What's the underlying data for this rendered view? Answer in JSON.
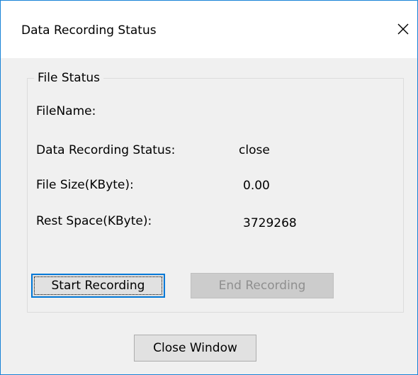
{
  "window": {
    "title": "Data Recording Status",
    "close_icon": "close-icon"
  },
  "file_status": {
    "group_title": "File Status",
    "filename_label": "FileName:",
    "filename_value": "",
    "recording_status_label": "Data Recording Status:",
    "recording_status_value": "close",
    "file_size_label": "File Size(KByte):",
    "file_size_value": "0.00",
    "rest_space_label": "Rest Space(KByte):",
    "rest_space_value": "3729268"
  },
  "buttons": {
    "start_recording": "Start Recording",
    "end_recording": "End Recording",
    "close_window": "Close Window"
  },
  "colors": {
    "window_border": "#1883d7",
    "focus_border": "#0078d7",
    "disabled_text": "#8f8f8f"
  }
}
